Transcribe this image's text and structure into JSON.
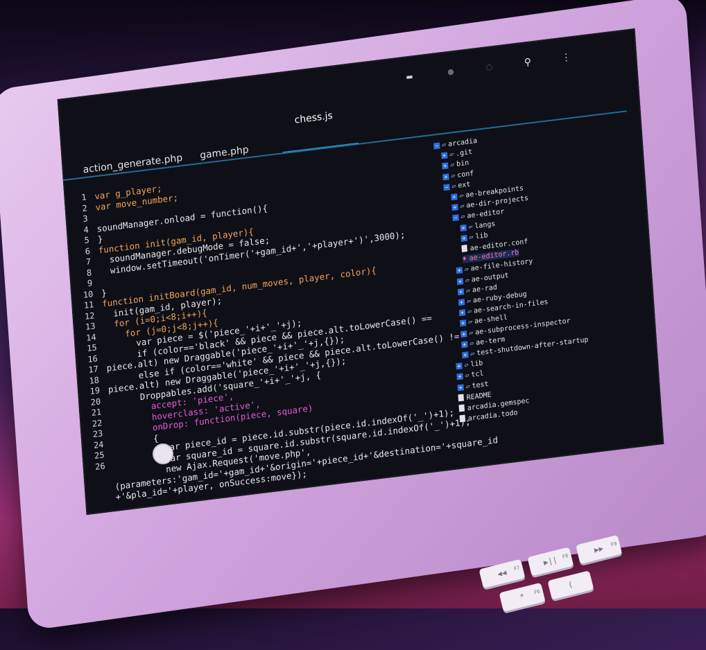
{
  "editor": {
    "tabs": [
      {
        "label": "action_generate.php",
        "active": false
      },
      {
        "label": "game.php",
        "active": false
      },
      {
        "label": "chess.js",
        "active": true
      }
    ],
    "toolbar_icons": [
      "keyboard-icon",
      "circle-icon",
      "refresh-icon",
      "search-icon",
      "overflow-menu-icon"
    ],
    "code_lines": [
      {
        "n": "1",
        "text": "var g_player;"
      },
      {
        "n": "2",
        "text": "var move_number;"
      },
      {
        "n": "3",
        "text": ""
      },
      {
        "n": "4",
        "text": "soundManager.onload = function(){"
      },
      {
        "n": "5",
        "text": "}"
      },
      {
        "n": "6",
        "text": "function init(gam_id, player){"
      },
      {
        "n": "7",
        "text": "  soundManager.debugMode = false;"
      },
      {
        "n": "8",
        "text": "  window.setTimeout('onTimer('+gam_id+','+player+')',3000);"
      },
      {
        "n": "9",
        "text": ""
      },
      {
        "n": "10",
        "text": "}"
      },
      {
        "n": "11",
        "text": "function initBoard(gam_id, num_moves, player, color){"
      },
      {
        "n": "12",
        "text": "  init(gam_id, player);"
      },
      {
        "n": "13",
        "text": "  for (i=0;i<8;i++){"
      },
      {
        "n": "14",
        "text": "    for (j=0;j<8;j++){"
      },
      {
        "n": "15",
        "text": "      var piece = $('piece_'+i+'_'+j);"
      },
      {
        "n": "16",
        "text": "      if (color=='black' && piece && piece.alt.toLowerCase() =="
      },
      {
        "n": "17",
        "text": "piece.alt) new Draggable('piece_'+i+'_'+j,{});"
      },
      {
        "n": "18",
        "text": "      else if (color=='white' && piece && piece.alt.toLowerCase() !="
      },
      {
        "n": "19",
        "text": "piece.alt) new Draggable('piece_'+i+'_'+j,{});"
      },
      {
        "n": "20",
        "text": "      Droppables.add('square_'+i+'_'+j, {"
      },
      {
        "n": "21",
        "text": "        accept: 'piece',"
      },
      {
        "n": "22",
        "text": "        hoverclass: 'active',"
      },
      {
        "n": "23",
        "text": "        onDrop: function(piece, square)"
      },
      {
        "n": "24",
        "text": "        {"
      },
      {
        "n": "25",
        "text": "          var piece_id = piece.id.substr(piece.id.indexOf('_')+1);"
      },
      {
        "n": "26",
        "text": "          var square_id = square.id.substr(square.id.indexOf('_')+1);"
      },
      {
        "n": "",
        "text": "          new Ajax.Request('move.php',"
      },
      {
        "n": "",
        "text": "(parameters:'gam_id='+gam_id+'&origin='+piece_id+'&destination='+square_id"
      },
      {
        "n": "",
        "text": "+'&pla_id='+player, onSuccess:move});"
      }
    ]
  },
  "tree": [
    {
      "label": "arcadia",
      "depth": 0,
      "kind": "root-open"
    },
    {
      "label": ".git",
      "depth": 1,
      "kind": "folder"
    },
    {
      "label": "bin",
      "depth": 1,
      "kind": "folder"
    },
    {
      "label": "conf",
      "depth": 1,
      "kind": "folder"
    },
    {
      "label": "ext",
      "depth": 1,
      "kind": "folder-open"
    },
    {
      "label": "ae-breakpoints",
      "depth": 2,
      "kind": "folder"
    },
    {
      "label": "ae-dir-projects",
      "depth": 2,
      "kind": "folder"
    },
    {
      "label": "ae-editor",
      "depth": 2,
      "kind": "folder-open"
    },
    {
      "label": "langs",
      "depth": 3,
      "kind": "folder"
    },
    {
      "label": "lib",
      "depth": 3,
      "kind": "folder"
    },
    {
      "label": "ae-editor.conf",
      "depth": 3,
      "kind": "file"
    },
    {
      "label": "ae-editor.rb",
      "depth": 3,
      "kind": "file-rb",
      "selected": true
    },
    {
      "label": "ae-file-history",
      "depth": 2,
      "kind": "folder"
    },
    {
      "label": "ae-output",
      "depth": 2,
      "kind": "folder"
    },
    {
      "label": "ae-rad",
      "depth": 2,
      "kind": "folder"
    },
    {
      "label": "ae-ruby-debug",
      "depth": 2,
      "kind": "folder"
    },
    {
      "label": "ae-search-in-files",
      "depth": 2,
      "kind": "folder"
    },
    {
      "label": "ae-shell",
      "depth": 2,
      "kind": "folder"
    },
    {
      "label": "ae-subprocess-inspector",
      "depth": 2,
      "kind": "folder"
    },
    {
      "label": "ae-term",
      "depth": 2,
      "kind": "folder"
    },
    {
      "label": "test-shutdown-after-startup",
      "depth": 2,
      "kind": "folder"
    },
    {
      "label": "lib",
      "depth": 1,
      "kind": "folder"
    },
    {
      "label": "tcl",
      "depth": 1,
      "kind": "folder"
    },
    {
      "label": "test",
      "depth": 1,
      "kind": "folder"
    },
    {
      "label": "README",
      "depth": 1,
      "kind": "file"
    },
    {
      "label": "arcadia.gemspec",
      "depth": 1,
      "kind": "file"
    },
    {
      "label": "arcadia.todo",
      "depth": 1,
      "kind": "file"
    }
  ],
  "keyboard": {
    "keys": [
      {
        "glyph": "◀◀",
        "fn": "F7"
      },
      {
        "glyph": "▶||",
        "fn": "F8"
      },
      {
        "glyph": "▶▶",
        "fn": "F9"
      },
      {
        "glyph": "*",
        "fn": "F6"
      },
      {
        "glyph": "(",
        "fn": ""
      }
    ]
  }
}
